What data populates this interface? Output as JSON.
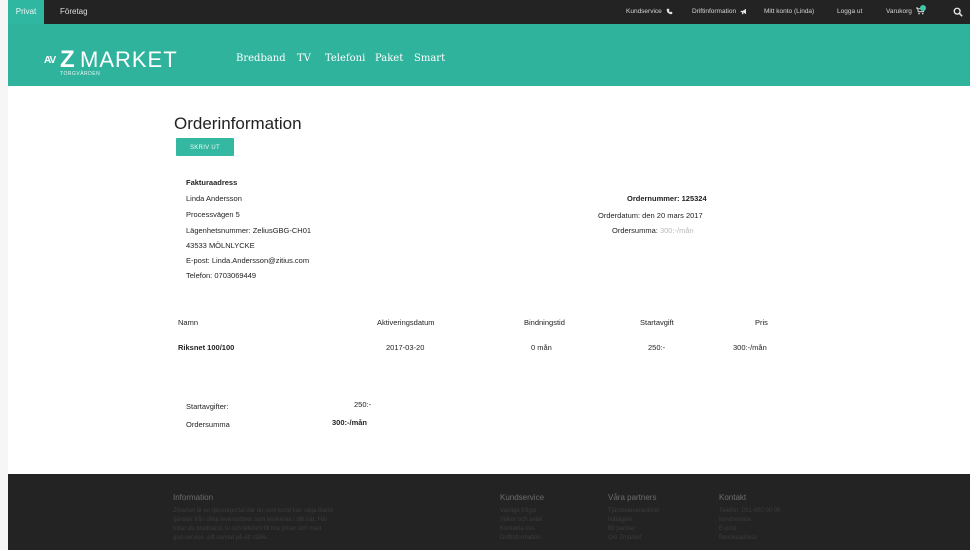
{
  "topbar": {
    "tabs": [
      {
        "label": "Privat",
        "active": true
      },
      {
        "label": "Företag",
        "active": false
      }
    ],
    "links": {
      "kundservice": "Kundservice",
      "driftinformation": "Driftinformation",
      "mitt_konto": "Mitt konto (Linda)",
      "logga_ut": "Logga ut",
      "varukorg": "Varukorg"
    },
    "icons": [
      "phone-icon",
      "megaphone-icon",
      "cart-icon",
      "search-icon"
    ]
  },
  "header": {
    "logo": {
      "mark": "AV",
      "z": "Z",
      "text": "MARKET",
      "sub": "TORGVÄRDEN"
    },
    "nav": [
      "Bredband",
      "TV",
      "Telefoni",
      "Paket",
      "Smart"
    ]
  },
  "order": {
    "title": "Orderinformation",
    "print_label": "SKRIV UT",
    "billing": {
      "heading": "Fakturaadress",
      "lines": [
        "Linda Andersson",
        "Processvägen 5",
        "Lägenhetsnummer: ZeliusGBG-CH01",
        "43533 MÖLNLYCKE",
        "E-post: Linda.Andersson@zitius.com",
        "Telefon: 0703069449"
      ]
    },
    "summary": {
      "order_number_label": "Ordernummer:",
      "order_number": "125324",
      "order_date": "Orderdatum: den 20 mars 2017",
      "order_sum_label": "Ordersumma:",
      "order_sum": "300:-/mån"
    },
    "table": {
      "headers": [
        "Namn",
        "Aktiveringsdatum",
        "Bindningstid",
        "Startavgift",
        "Pris"
      ],
      "rows": [
        [
          "Riksnet 100/100",
          "2017-03-20",
          "0 mån",
          "250:-",
          "300:-/mån"
        ]
      ]
    },
    "totals": {
      "startfee_label": "Startavgifter:",
      "startfee_value": "250:-",
      "sum_label": "Ordersumma",
      "sum_value": "300:-/mån"
    }
  },
  "footer": {
    "columns": [
      {
        "heading": "Information",
        "lines": [
          "Zmarket är en tjänsteportal där du som kund kan välja bland",
          "tjänster från olika leverantörer som levereras i ditt nät. Här",
          "hittar du bredband, tv och telefoni till bra priser och med",
          "god service, allt samlat på ett ställe."
        ]
      },
      {
        "heading": "Kundservice",
        "lines": [
          "Vanliga frågor",
          "Villkor och avtal",
          "Kontakta oss",
          "Driftinformation"
        ]
      },
      {
        "heading": "Våra partners",
        "lines": [
          "Tjänsteleverantörer",
          "Nätägare",
          "Bli partner",
          "Om Zmarket"
        ]
      },
      {
        "heading": "Kontakt",
        "lines": [
          "Telefon: 031-000 00 00",
          "kundservice",
          "E-post",
          "Besöksadress"
        ]
      }
    ]
  },
  "colors": {
    "brand_green": "#30b39d",
    "topbar_dark": "#232323",
    "footer_dark": "#232323",
    "button_green": "#35b8a2",
    "cart_badge": "#3fc9a9"
  }
}
